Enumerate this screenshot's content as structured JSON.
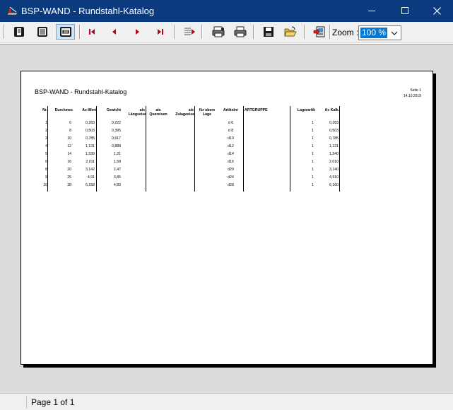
{
  "window": {
    "title": "BSP-WAND - Rundstahl-Katalog",
    "titlebar_color": "#0b3a7e"
  },
  "toolbar": {
    "buttons": [
      {
        "name": "single-page-icon",
        "tooltip": ""
      },
      {
        "name": "multi-page-icon",
        "tooltip": ""
      },
      {
        "name": "page-width-icon",
        "tooltip": "",
        "active": true
      },
      {
        "name": "first-page-icon"
      },
      {
        "name": "prev-page-icon"
      },
      {
        "name": "next-page-icon"
      },
      {
        "name": "last-page-icon"
      },
      {
        "name": "goto-page-icon"
      },
      {
        "name": "print-setup-icon"
      },
      {
        "name": "print-icon"
      },
      {
        "name": "save-icon"
      },
      {
        "name": "open-icon"
      },
      {
        "name": "export-icon"
      }
    ],
    "zoom_label": "Zoom :",
    "zoom_value": "100 %"
  },
  "report": {
    "title": "BSP-WAND - Rundstahl-Katalog",
    "page_label": "Seite 1",
    "date": "14.10.2019",
    "headers": {
      "nr": "Nr.",
      "durchmes": "Durchmes",
      "as_wert": "As-Wert",
      "gewicht": "Gewicht",
      "als_laengseise_1": "als",
      "als_laengseise_2": "Längseise",
      "als_quereisen_1": "als",
      "als_quereisen_2": "Quereisen",
      "als_zulageeise_1": "als",
      "als_zulageeise_2": "Zulageeise",
      "fuer_obere_1": "für obere",
      "fuer_obere_2": "Lage",
      "artikelnr": "Artikelnr",
      "artgruppe": "ARTGRUPPE",
      "lagerartik": "Lagerartik",
      "as_kalk": "As Kalk."
    },
    "rows": [
      {
        "nr": "1",
        "d": "6",
        "as": "0,283",
        "g": "0,222",
        "art": "d 6",
        "lag": "1",
        "k": "0,283"
      },
      {
        "nr": "2",
        "d": "8",
        "as": "0,503",
        "g": "0,395",
        "art": "d 8",
        "lag": "1",
        "k": "0,503"
      },
      {
        "nr": "3",
        "d": "10",
        "as": "0,785",
        "g": "0,617",
        "art": "d10",
        "lag": "1",
        "k": "0,785"
      },
      {
        "nr": "4",
        "d": "12",
        "as": "1,131",
        "g": "0,888",
        "art": "d12",
        "lag": "1",
        "k": "1,131"
      },
      {
        "nr": "5",
        "d": "14",
        "as": "1,539",
        "g": "1,21",
        "art": "d14",
        "lag": "1",
        "k": "1,540"
      },
      {
        "nr": "6",
        "d": "16",
        "as": "2,011",
        "g": "1,58",
        "art": "d16",
        "lag": "1",
        "k": "2,010"
      },
      {
        "nr": "8",
        "d": "20",
        "as": "3,142",
        "g": "2,47",
        "art": "d20",
        "lag": "1",
        "k": "3,140"
      },
      {
        "nr": "9",
        "d": "25",
        "as": "4,91",
        "g": "3,85",
        "art": "d24",
        "lag": "1",
        "k": "4,910"
      },
      {
        "nr": "10",
        "d": "28",
        "as": "6,158",
        "g": "4,83",
        "art": "d28",
        "lag": "1",
        "k": "6,160"
      }
    ]
  },
  "status": {
    "page_text": "Page 1 of 1"
  }
}
